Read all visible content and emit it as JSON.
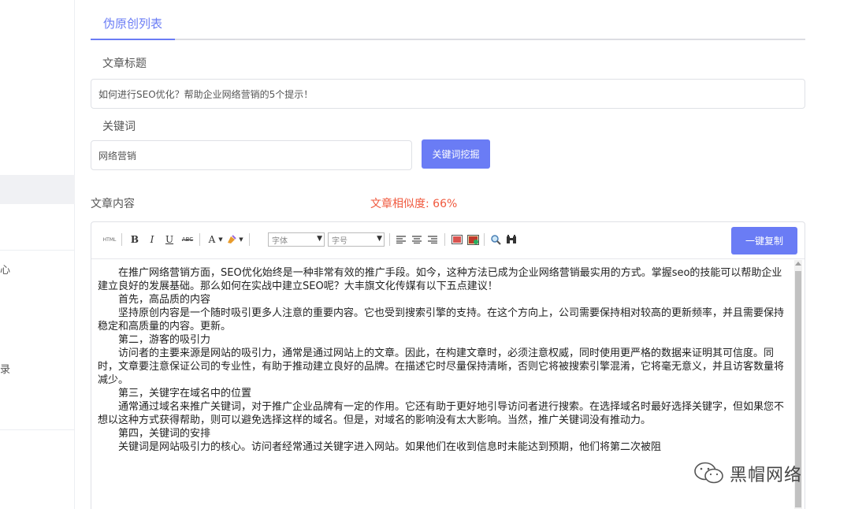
{
  "sidebar": {
    "fragment_1": "心",
    "fragment_2": "录"
  },
  "tabs": {
    "active_label": "伪原创列表"
  },
  "form": {
    "title_label": "文章标题",
    "title_value": "如何进行SEO优化？帮助企业网络营销的5个提示！",
    "keyword_label": "关键词",
    "keyword_value": "网络营销",
    "keyword_button": "关键词挖掘",
    "content_label": "文章内容",
    "similarity_text": "文章相似度: 66%"
  },
  "editor": {
    "toolbar": {
      "html": "HTML",
      "bold": "B",
      "italic": "I",
      "underline": "U",
      "strike": "ABC",
      "font_color": "A",
      "font_family_placeholder": "字体",
      "font_size_placeholder": "字号",
      "copy_button": "一键复制"
    },
    "paragraphs": [
      "在推广网络营销方面，SEO优化始终是一种非常有效的推广手段。如今，这种方法已成为企业网络营销最实用的方式。掌握seo的技能可以帮助企业建立良好的发展基础。那么如何在实战中建立SEO呢？大丰旗文化传媒有以下五点建议！",
      "首先，高品质的内容",
      "坚持原创内容是一个随时吸引更多人注意的重要内容。它也受到搜索引擎的支持。在这个方向上，公司需要保持相对较高的更新频率，并且需要保持稳定和高质量的内容。更新。",
      "第二，游客的吸引力",
      "访问者的主要来源是网站的吸引力，通常是通过网站上的文章。因此，在构建文章时，必须注意权威，同时使用更严格的数据来证明其可信度。同时，文章要注意保证公司的专业性，有助于推动建立良好的品牌。在描述它时尽量保持清晰，否则它将被搜索引擎混淆，它将毫无意义，并且访客数量将减少。",
      "第三，关键字在域名中的位置",
      "通常通过域名来推广关键词，对于推广企业品牌有一定的作用。它还有助于更好地引导访问者进行搜索。在选择域名时最好选择关键字，但如果您不想以这种方式获得帮助，则可以避免选择这样的域名。但是，对域名的影响没有太大影响。当然，推广关键词没有推动力。",
      "第四，关键词的安排",
      "关键词是网站吸引力的核心。访问者经常通过关键字进入网站。如果他们在收到信息时未能达到预期，他们将第二次被阻"
    ]
  },
  "watermark": {
    "text": "黑帽网络",
    "icon": "wechat-icon"
  },
  "colors": {
    "accent": "#6a7cf5",
    "similarity": "#f0593e"
  }
}
